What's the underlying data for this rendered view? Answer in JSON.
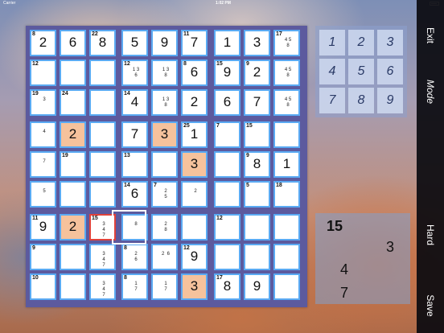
{
  "status": {
    "carrier": "Carrier",
    "time": "1:02 PM"
  },
  "board": {
    "rows": [
      [
        {
          "v": "2",
          "c": "8"
        },
        {
          "v": "6"
        },
        {
          "v": "8",
          "c": "22"
        },
        {
          "v": "5"
        },
        {
          "v": "9"
        },
        {
          "v": "7",
          "c": "11"
        },
        {
          "v": "1"
        },
        {
          "v": "3"
        },
        {
          "c": "17",
          "p": "4 5\n8"
        }
      ],
      [
        {
          "c": "12"
        },
        {},
        {},
        {
          "c": "12",
          "p": "1 3\n6"
        },
        {
          "p": "1 3\n8"
        },
        {
          "v": "6",
          "c": "8"
        },
        {
          "v": "9",
          "c": "15"
        },
        {
          "v": "2",
          "c": "9"
        },
        {
          "p": "4 5\n8"
        }
      ],
      [
        {
          "c": "19",
          "p": "3"
        },
        {
          "c": "24"
        },
        {},
        {
          "v": "4",
          "c": "14"
        },
        {
          "p": "1 3\n8"
        },
        {
          "v": "2"
        },
        {
          "v": "6"
        },
        {
          "v": "7"
        },
        {
          "p": "4 5\n8"
        }
      ],
      [
        {
          "p": "4"
        },
        {
          "v": "2",
          "hl": true
        },
        {},
        {
          "v": "7"
        },
        {
          "v": "3",
          "hl": true
        },
        {
          "v": "1",
          "c": "25"
        },
        {
          "c": "7"
        },
        {
          "c": "15"
        },
        {}
      ],
      [
        {
          "p": "7"
        },
        {
          "c": "19"
        },
        {},
        {
          "c": "13"
        },
        {},
        {
          "v": "3",
          "hl": true
        },
        {},
        {
          "v": "8",
          "c": "9"
        },
        {
          "v": "1"
        }
      ],
      [
        {
          "p": "5"
        },
        {},
        {},
        {
          "v": "6",
          "c": "14"
        },
        {
          "c": "7",
          "p": "2\n5"
        },
        {
          "p": "2"
        },
        {},
        {
          "c": "5"
        },
        {
          "c": "18"
        }
      ],
      [
        {
          "v": "9",
          "c": "11"
        },
        {
          "v": "2",
          "hl": true
        },
        {
          "c": "15",
          "p": "3\n4\n7",
          "sel": true
        },
        {
          "p": "8"
        },
        {
          "p": "2\n8"
        },
        {},
        {
          "c": "12"
        },
        {},
        {}
      ],
      [
        {
          "c": "9"
        },
        {},
        {
          "p": "3\n4\n7"
        },
        {
          "c": "8",
          "p": "2\n6"
        },
        {
          "p": "2  6"
        },
        {
          "v": "9",
          "c": "12"
        },
        {},
        {},
        {}
      ],
      [
        {
          "c": "10"
        },
        {},
        {
          "p": "3\n4\n7"
        },
        {
          "c": "8",
          "p": "1\n7"
        },
        {
          "p": "1\n7"
        },
        {
          "v": "3",
          "hl": true
        },
        {
          "v": "8",
          "c": "17"
        },
        {
          "v": "9"
        },
        {}
      ]
    ]
  },
  "keypad": {
    "keys": [
      "1",
      "2",
      "3",
      "4",
      "5",
      "6",
      "7",
      "8",
      "9"
    ]
  },
  "side_buttons": {
    "exit": "Exit",
    "mode": "Mode",
    "hard": "Hard",
    "save": "Save"
  },
  "info": {
    "sum": "15",
    "candidates": [
      "3",
      "4",
      "7"
    ]
  }
}
